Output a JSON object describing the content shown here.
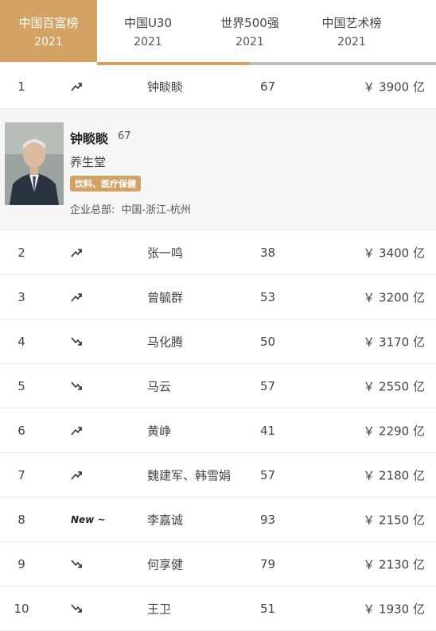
{
  "tabs": [
    {
      "label": "中国百富榜",
      "year": "2021",
      "active": true
    },
    {
      "label": "中国U30",
      "year": "2021",
      "active": false
    },
    {
      "label": "世界500强",
      "year": "2021",
      "active": false
    },
    {
      "label": "中国艺术榜",
      "year": "2021",
      "active": false
    }
  ],
  "colors": {
    "accent": "#d4a263",
    "tab_underline": "#bdbdbd",
    "detail_bg": "#f6f6f6"
  },
  "detail": {
    "name": "钟睒睒",
    "age": "67",
    "company": "养生堂",
    "industry": "饮料、医疗保健",
    "hq_label": "企业总部:",
    "hq_value": "中国-浙江-杭州"
  },
  "rows": [
    {
      "rank": "1",
      "trend": "up",
      "name": "钟睒睒",
      "age": "67",
      "wealth": "￥ 3900 亿"
    },
    {
      "rank": "2",
      "trend": "up",
      "name": "张一鸣",
      "age": "38",
      "wealth": "￥ 3400 亿"
    },
    {
      "rank": "3",
      "trend": "up",
      "name": "曾毓群",
      "age": "53",
      "wealth": "￥ 3200 亿"
    },
    {
      "rank": "4",
      "trend": "down",
      "name": "马化腾",
      "age": "50",
      "wealth": "￥ 3170 亿"
    },
    {
      "rank": "5",
      "trend": "down",
      "name": "马云",
      "age": "57",
      "wealth": "￥ 2550 亿"
    },
    {
      "rank": "6",
      "trend": "up",
      "name": "黄峥",
      "age": "41",
      "wealth": "￥ 2290 亿"
    },
    {
      "rank": "7",
      "trend": "up",
      "name": "魏建军、韩雪娟",
      "age": "57",
      "wealth": "￥ 2180 亿"
    },
    {
      "rank": "8",
      "trend": "new",
      "new_label": "New ~",
      "name": "李嘉诚",
      "age": "93",
      "wealth": "￥ 2150 亿"
    },
    {
      "rank": "9",
      "trend": "down",
      "name": "何享健",
      "age": "79",
      "wealth": "￥ 2130 亿"
    },
    {
      "rank": "10",
      "trend": "down",
      "name": "王卫",
      "age": "51",
      "wealth": "￥ 1930 亿"
    }
  ]
}
